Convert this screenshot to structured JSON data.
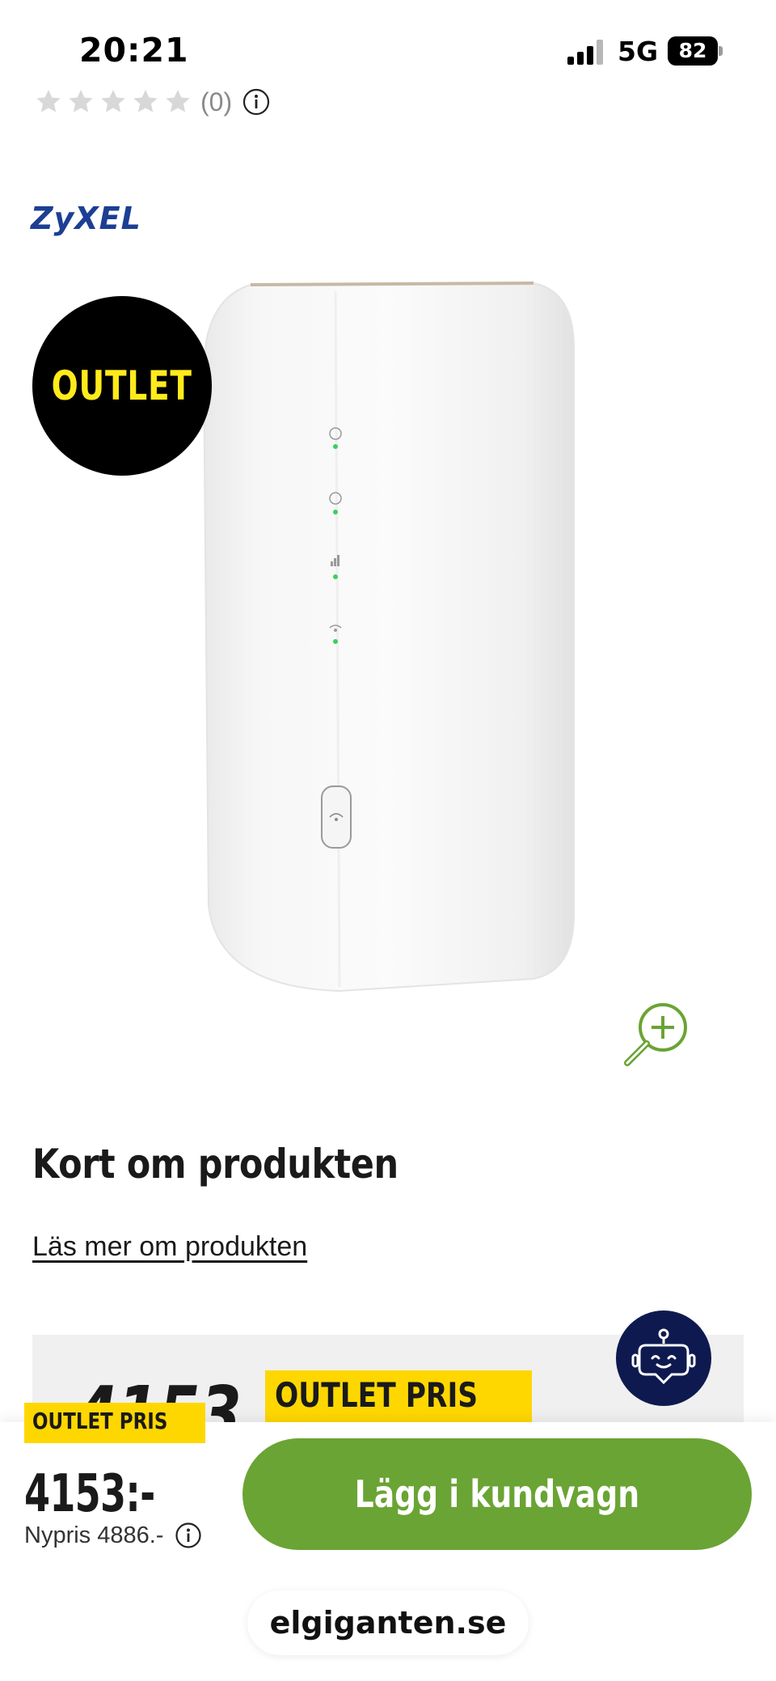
{
  "status_bar": {
    "time": "20:21",
    "network": "5G",
    "battery": "82",
    "icons": [
      "signal-icon",
      "battery-icon"
    ]
  },
  "rating": {
    "count": "(0)",
    "stars_filled": 0,
    "stars_total": 5,
    "icons": [
      "star-icon",
      "info-icon"
    ]
  },
  "brand": "ZyXEL",
  "badge": "OUTLET",
  "icons": {
    "zoom": "zoom-in-icon",
    "chat": "chatbot-icon"
  },
  "colors": {
    "brand_blue": "#1c3f94",
    "outlet_yellow": "#ffd700",
    "badge_text_yellow": "#ffeb1a",
    "cta_green": "#6aa434",
    "chat_navy": "#0e1a4f"
  },
  "about": {
    "title": "Kort om produkten",
    "read_more": "Läs mer om produkten"
  },
  "price_box": {
    "price_partial": "4153",
    "label": "OUTLET PRIS"
  },
  "sticky": {
    "label": "OUTLET PRIS",
    "price": "4153:-",
    "old_price": "Nypris 4886.-",
    "cta": "Lägg i kundvagn"
  },
  "url": "elgiganten.se"
}
